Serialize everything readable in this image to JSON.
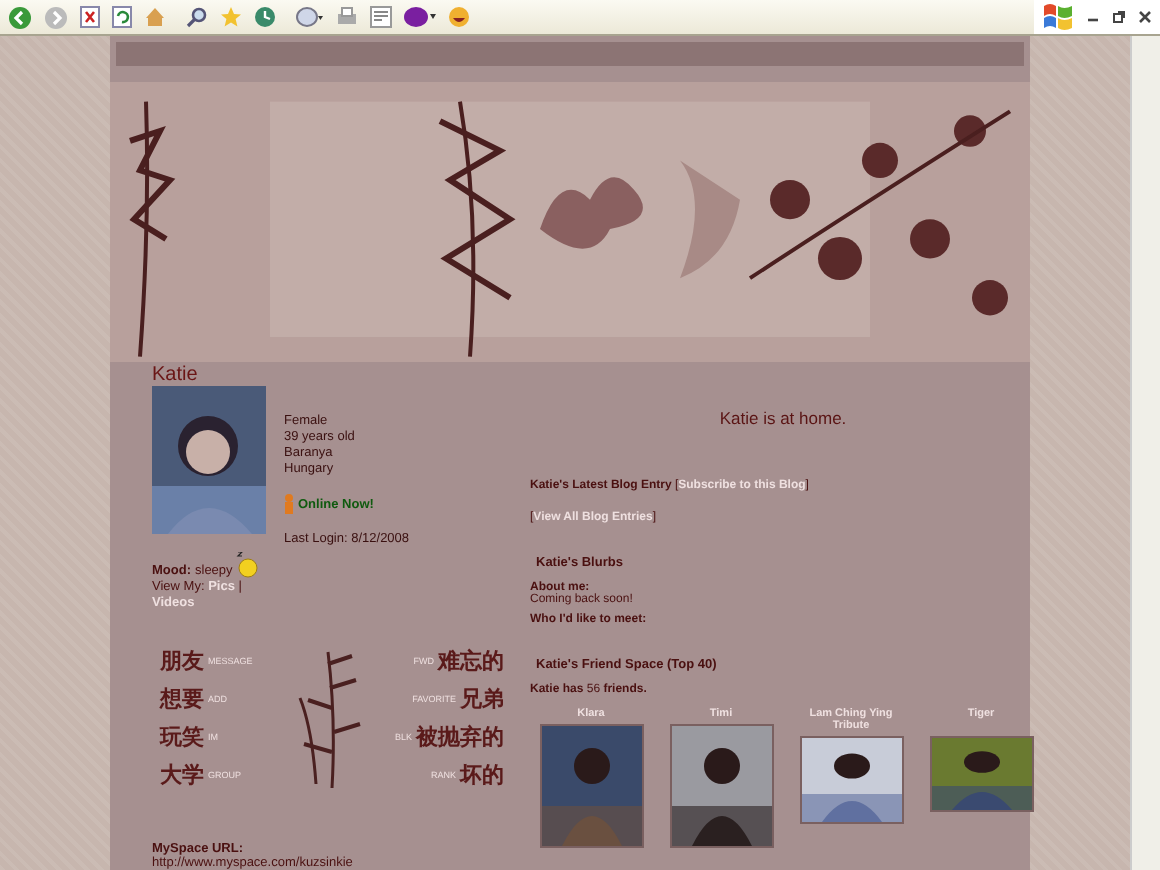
{
  "profile": {
    "name": "Katie",
    "details": [
      "Female",
      "39 years old",
      "Baranya",
      "Hungary"
    ],
    "online": "Online Now!",
    "last_login": "Last Login: 8/12/2008",
    "mood_label": "Mood:",
    "mood": "sleepy",
    "view_label": "View My:",
    "links": [
      "Pics",
      "Videos"
    ],
    "separator": "|"
  },
  "contact": {
    "left": [
      {
        "chinese": "朋友",
        "label": "MESSAGE"
      },
      {
        "chinese": "想要",
        "label": "ADD"
      },
      {
        "chinese": "玩笑",
        "label": "IM"
      },
      {
        "chinese": "大学",
        "label": "GROUP"
      }
    ],
    "right": [
      {
        "label": "FWD",
        "chinese": "难忘的"
      },
      {
        "label": "FAVORITE",
        "chinese": "兄弟"
      },
      {
        "label": "BLK",
        "chinese": "被抛弃的"
      },
      {
        "label": "RANK",
        "chinese": "坏的"
      }
    ]
  },
  "url": {
    "label": "MySpace URL:",
    "value": "http://www.myspace.com/kuzsinkie"
  },
  "status": "Katie is at home.",
  "blog": {
    "title": "Katie's Latest Blog Entry",
    "open": "[",
    "close": "]",
    "subscribe": "Subscribe to this Blog",
    "view_all": "View All Blog Entries"
  },
  "blurbs": {
    "title": "Katie's Blurbs",
    "sections": [
      {
        "heading": "About me:",
        "text": "Coming back soon!"
      },
      {
        "heading": "Who I'd like to meet:"
      }
    ]
  },
  "friends": {
    "title": "Katie's Friend Space (Top 40)",
    "count": "**Katie has** 56 **friends.**",
    "list": [
      {
        "name": "Klara"
      },
      {
        "name": "Timi"
      },
      {
        "name": "Lam Ching Ying Tribute"
      },
      {
        "name": "Tiger"
      }
    ]
  }
}
